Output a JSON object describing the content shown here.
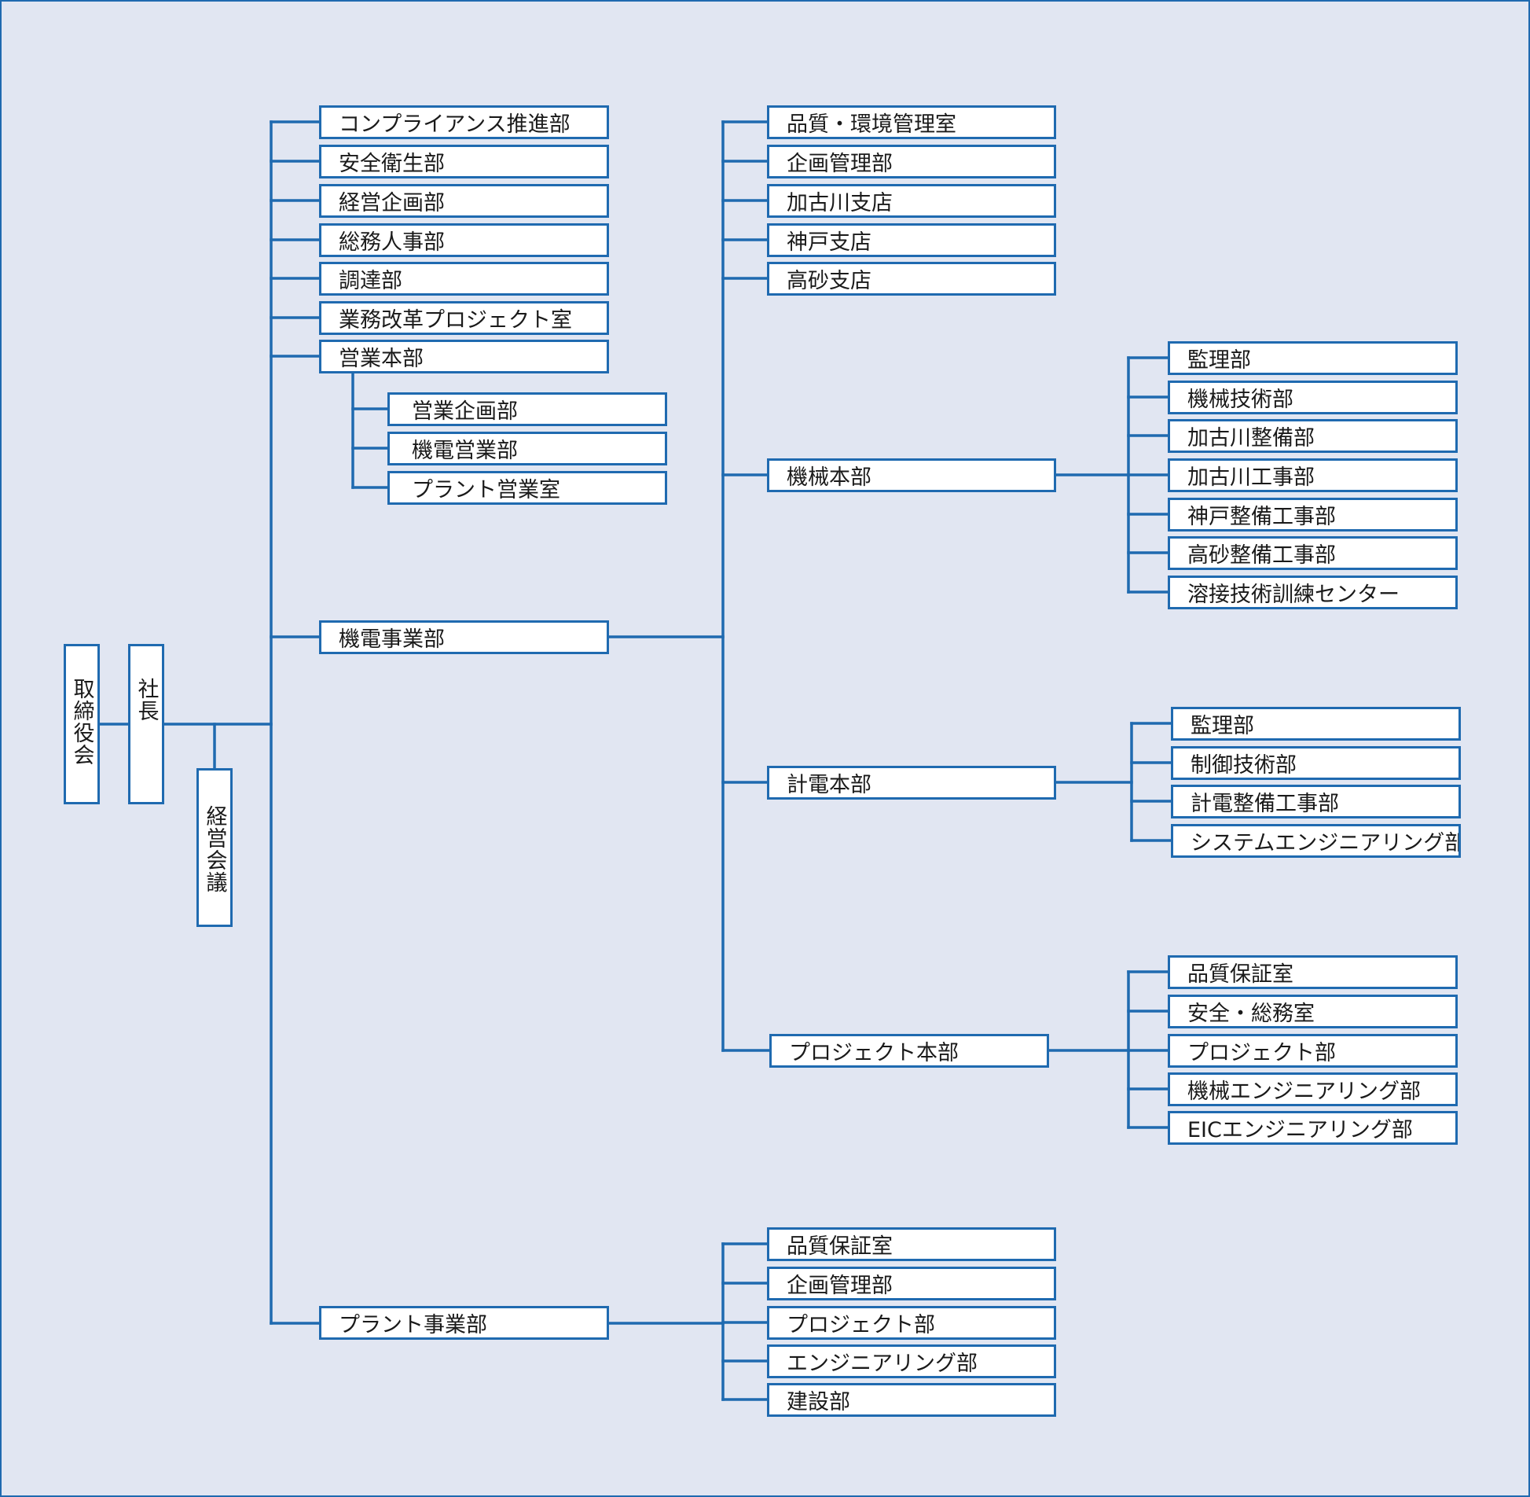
{
  "colors": {
    "background": "#e1e6f2",
    "line": "#1f6ab0",
    "box_fill": "#ffffff",
    "text": "#1a1a1a"
  },
  "board": "取締役会",
  "president": "社長",
  "management_meeting": "経営会議",
  "corporate_departments": [
    "コンプライアンス推進部",
    "安全衛生部",
    "経営企画部",
    "総務人事部",
    "調達部",
    "業務改革プロジェクト室",
    "営業本部"
  ],
  "sales_hq_departments": [
    "営業企画部",
    "機電営業部",
    "プラント営業室"
  ],
  "kiden_division": {
    "label": "機電事業部",
    "staff": [
      "品質・環境管理室",
      "企画管理部",
      "加古川支店",
      "神戸支店",
      "高砂支店"
    ],
    "machinery_hq": {
      "label": "機械本部",
      "departments": [
        "監理部",
        "機械技術部",
        "加古川整備部",
        "加古川工事部",
        "神戸整備工事部",
        "高砂整備工事部",
        "溶接技術訓練センター"
      ]
    },
    "instrumentation_hq": {
      "label": "計電本部",
      "departments": [
        "監理部",
        "制御技術部",
        "計電整備工事部",
        "システムエンジニアリング部"
      ]
    },
    "project_hq": {
      "label": "プロジェクト本部",
      "departments": [
        "品質保証室",
        "安全・総務室",
        "プロジェクト部",
        "機械エンジニアリング部",
        "EICエンジニアリング部"
      ]
    }
  },
  "plant_division": {
    "label": "プラント事業部",
    "departments": [
      "品質保証室",
      "企画管理部",
      "プロジェクト部",
      "エンジニアリング部",
      "建設部"
    ]
  }
}
